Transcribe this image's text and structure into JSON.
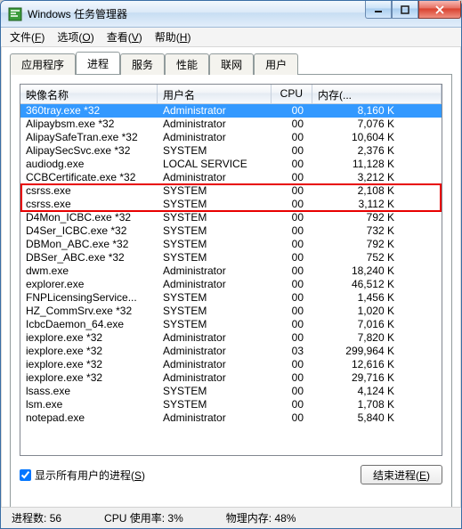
{
  "window": {
    "title": "Windows 任务管理器"
  },
  "menu": {
    "file": {
      "label": "文件",
      "key": "F"
    },
    "options": {
      "label": "选项",
      "key": "O"
    },
    "view": {
      "label": "查看",
      "key": "V"
    },
    "help": {
      "label": "帮助",
      "key": "H"
    }
  },
  "tabs": [
    {
      "id": "apps",
      "label": "应用程序"
    },
    {
      "id": "proc",
      "label": "进程"
    },
    {
      "id": "services",
      "label": "服务"
    },
    {
      "id": "perf",
      "label": "性能"
    },
    {
      "id": "net",
      "label": "联网"
    },
    {
      "id": "users",
      "label": "用户"
    }
  ],
  "activeTab": "proc",
  "columns": {
    "image": "映像名称",
    "user": "用户名",
    "cpu": "CPU",
    "mem": "内存(..."
  },
  "processes": [
    {
      "image": "360tray.exe *32",
      "user": "Administrator",
      "cpu": "00",
      "mem": "8,160 K",
      "selected": true
    },
    {
      "image": "Alipaybsm.exe *32",
      "user": "Administrator",
      "cpu": "00",
      "mem": "7,076 K"
    },
    {
      "image": "AlipaySafeTran.exe *32",
      "user": "Administrator",
      "cpu": "00",
      "mem": "10,604 K"
    },
    {
      "image": "AlipaySecSvc.exe *32",
      "user": "SYSTEM",
      "cpu": "00",
      "mem": "2,376 K"
    },
    {
      "image": "audiodg.exe",
      "user": "LOCAL SERVICE",
      "cpu": "00",
      "mem": "11,128 K"
    },
    {
      "image": "CCBCertificate.exe *32",
      "user": "Administrator",
      "cpu": "00",
      "mem": "3,212 K"
    },
    {
      "image": "csrss.exe",
      "user": "SYSTEM",
      "cpu": "00",
      "mem": "2,108 K",
      "hl": true
    },
    {
      "image": "csrss.exe",
      "user": "SYSTEM",
      "cpu": "00",
      "mem": "3,112 K",
      "hl": true
    },
    {
      "image": "D4Mon_ICBC.exe *32",
      "user": "SYSTEM",
      "cpu": "00",
      "mem": "792 K"
    },
    {
      "image": "D4Ser_ICBC.exe *32",
      "user": "SYSTEM",
      "cpu": "00",
      "mem": "732 K"
    },
    {
      "image": "DBMon_ABC.exe *32",
      "user": "SYSTEM",
      "cpu": "00",
      "mem": "792 K"
    },
    {
      "image": "DBSer_ABC.exe *32",
      "user": "SYSTEM",
      "cpu": "00",
      "mem": "752 K"
    },
    {
      "image": "dwm.exe",
      "user": "Administrator",
      "cpu": "00",
      "mem": "18,240 K"
    },
    {
      "image": "explorer.exe",
      "user": "Administrator",
      "cpu": "00",
      "mem": "46,512 K"
    },
    {
      "image": "FNPLicensingService...",
      "user": "SYSTEM",
      "cpu": "00",
      "mem": "1,456 K"
    },
    {
      "image": "HZ_CommSrv.exe *32",
      "user": "SYSTEM",
      "cpu": "00",
      "mem": "1,020 K"
    },
    {
      "image": "IcbcDaemon_64.exe",
      "user": "SYSTEM",
      "cpu": "00",
      "mem": "7,016 K"
    },
    {
      "image": "iexplore.exe *32",
      "user": "Administrator",
      "cpu": "00",
      "mem": "7,820 K"
    },
    {
      "image": "iexplore.exe *32",
      "user": "Administrator",
      "cpu": "03",
      "mem": "299,964 K"
    },
    {
      "image": "iexplore.exe *32",
      "user": "Administrator",
      "cpu": "00",
      "mem": "12,616 K"
    },
    {
      "image": "iexplore.exe *32",
      "user": "Administrator",
      "cpu": "00",
      "mem": "29,716 K"
    },
    {
      "image": "lsass.exe",
      "user": "SYSTEM",
      "cpu": "00",
      "mem": "4,124 K"
    },
    {
      "image": "lsm.exe",
      "user": "SYSTEM",
      "cpu": "00",
      "mem": "1,708 K"
    },
    {
      "image": "notepad.exe",
      "user": "Administrator",
      "cpu": "00",
      "mem": "5,840 K"
    }
  ],
  "showAll": {
    "label": "显示所有用户的进程",
    "key": "S",
    "checked": true
  },
  "endBtn": {
    "label": "结束进程",
    "key": "E"
  },
  "status": {
    "procCount": {
      "label": "进程数:",
      "value": "56"
    },
    "cpuUsage": {
      "label": "CPU 使用率:",
      "value": "3%"
    },
    "memUsage": {
      "label": "物理内存:",
      "value": "48%"
    }
  }
}
